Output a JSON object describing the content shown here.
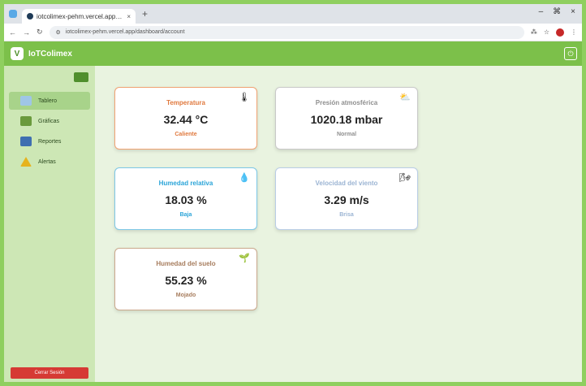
{
  "browser": {
    "tab_title": "iotcolimex-pehm.vercel.app/dashb...",
    "tab_close": "×",
    "new_tab": "+",
    "url": "iotcolimex-pehm.vercel.app/dashboard/account",
    "window_controls": [
      "–",
      "⌘",
      "×"
    ]
  },
  "app": {
    "brand": "IoTColimex",
    "logo_glyph": "V",
    "header_button_glyph": "⏻"
  },
  "sidebar": {
    "items": [
      {
        "label": "Tablero",
        "icon": "dashboard-icon",
        "color": "#9fc6e6",
        "active": true
      },
      {
        "label": "Gráficas",
        "icon": "bar-chart-icon",
        "color": "#6a9a3c",
        "active": false
      },
      {
        "label": "Reportes",
        "icon": "reports-icon",
        "color": "#3f6fb0",
        "active": false
      },
      {
        "label": "Alertas",
        "icon": "warning-icon",
        "color": "#e6b31e",
        "active": false
      }
    ],
    "logout_label": "Cerrar Sesión"
  },
  "cards": {
    "temperature": {
      "title": "Temperatura",
      "value": "32.44 °C",
      "status": "Caliente",
      "icon": "thermometer-icon",
      "glyph": "🌡"
    },
    "pressure": {
      "title": "Presión atmosférica",
      "value": "1020.18 mbar",
      "status": "Normal",
      "icon": "pressure-icon",
      "glyph": "⛅"
    },
    "humidity": {
      "title": "Humedad relativa",
      "value": "18.03 %",
      "status": "Baja",
      "icon": "droplet-icon",
      "glyph": "💧"
    },
    "wind": {
      "title": "Velocidad del viento",
      "value": "3.29 m/s",
      "status": "Brisa",
      "icon": "wind-icon",
      "glyph": "🌬"
    },
    "soil": {
      "title": "Humedad del suelo",
      "value": "55.23 %",
      "status": "Mojado",
      "icon": "soil-icon",
      "glyph": "🌱"
    }
  },
  "colors": {
    "accent": "#7cc04a",
    "sidebar_bg": "#cde7b5",
    "main_bg": "#e9f3e0",
    "logout": "#d63a34"
  }
}
